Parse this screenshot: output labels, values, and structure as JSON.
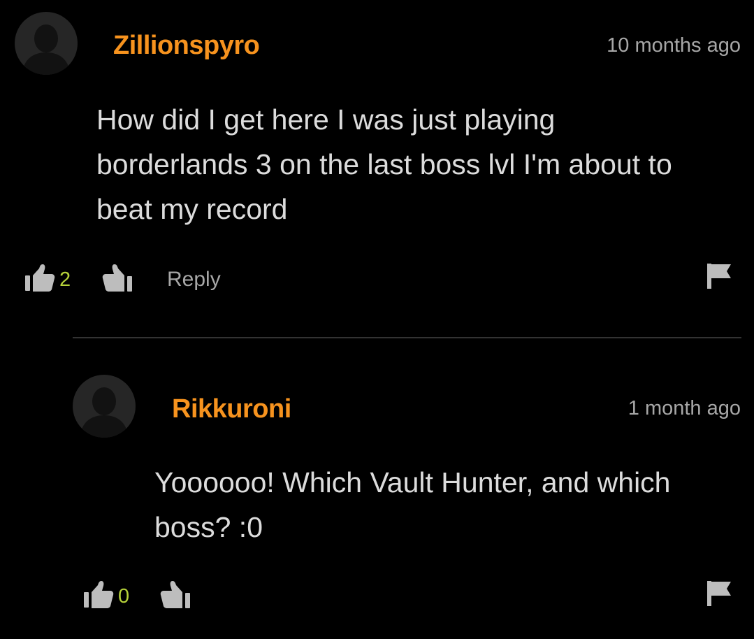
{
  "colors": {
    "background": "#000000",
    "username": "#f7931e",
    "upvote_count": "#b6d23a",
    "muted_text": "#a7a7a7",
    "body_text": "#dcdcdc",
    "icon": "#bdbdbd",
    "avatar_bg": "#262626"
  },
  "comments": [
    {
      "username": "Zillionspyro",
      "timestamp": "10 months ago",
      "body_lines": [
        "How did I get here I was just playing",
        "borderlands 3 on the last boss lvl I'm about to",
        "beat my record"
      ],
      "upvotes": "2",
      "reply_label": "Reply",
      "icons": [
        "avatar-silhouette-icon",
        "thumbs-up-icon",
        "thumbs-down-icon",
        "flag-icon"
      ]
    },
    {
      "username": "Rikkuroni",
      "timestamp": "1 month ago",
      "body_lines": [
        "Yoooooo! Which Vault Hunter, and which",
        "boss? :0"
      ],
      "upvotes": "0",
      "icons": [
        "avatar-silhouette-icon",
        "thumbs-up-icon",
        "thumbs-down-icon",
        "flag-icon"
      ]
    }
  ]
}
